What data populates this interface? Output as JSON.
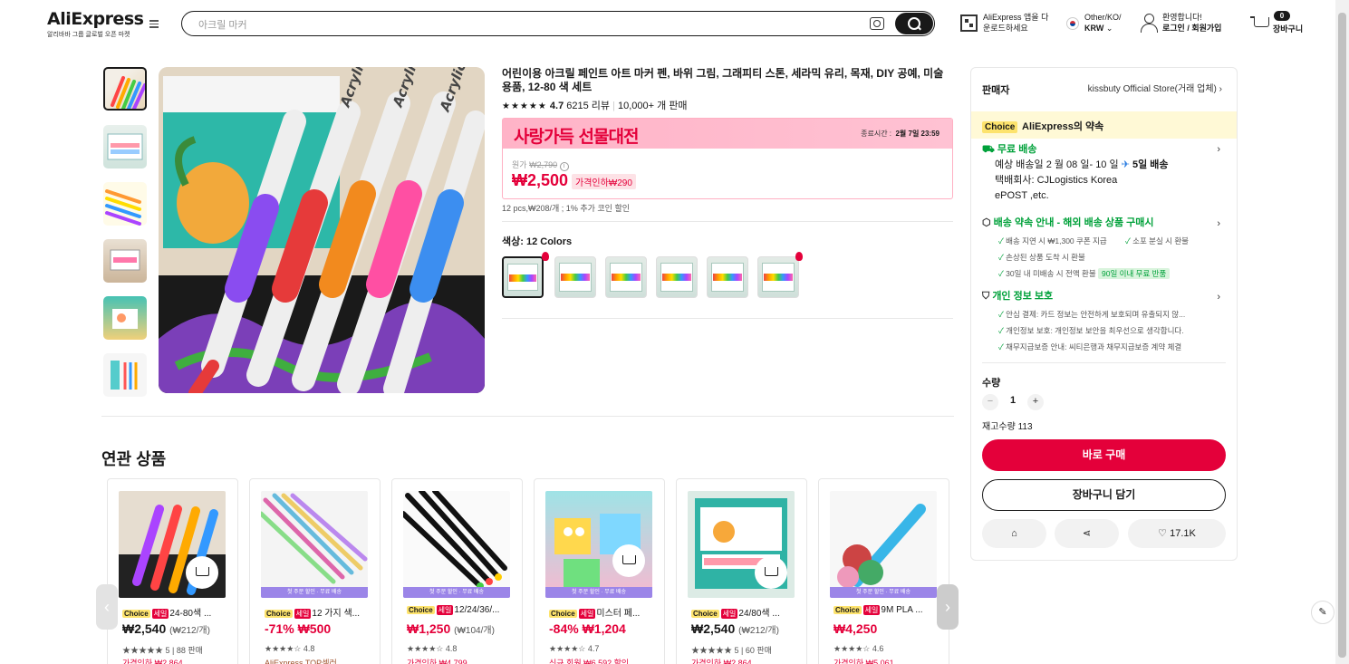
{
  "header": {
    "logo": "AliExpress",
    "logo_sub": "알리바바 그룹 글로벌 오픈 마켓",
    "search_placeholder": "아크릴 마커",
    "app_line1": "AliExpress 앱을 다",
    "app_line2": "운로드하세요",
    "locale_line1": "Other/KO/",
    "locale_line2": "KRW",
    "greeting": "환영합니다!",
    "login": "로그인 / 회원가입",
    "cart_count": "0",
    "cart_label": "장바구니"
  },
  "product": {
    "title": "어린이용 아크릴 페인트 아트 마커 펜, 바위 그림, 그래피티 스톤, 세라믹 유리, 목재, DIY 공예, 미술 용품, 12-80 색 세트",
    "stars": "★★★★★",
    "rating": "4.7",
    "reviews": "6215 리뷰",
    "sold": "10,000+ 개 판매",
    "promo_title": "사랑가득 선물대전",
    "promo_time_label": "종료시간 :",
    "promo_time": "2월 7일 23:59",
    "orig_label": "원가",
    "orig_price": "₩2,790",
    "price": "₩2,500",
    "discount": "가격인하₩290",
    "unit_note": "12 pcs,₩208/개 ; 1% 추가 코인 할인",
    "color_label": "색상: 12 Colors"
  },
  "seller": {
    "label": "판매자",
    "name": "kissbuty Official Store(거래 업체)",
    "choice_badge": "Choice",
    "promise": "AliExpress의 약속",
    "free_shipping": "무료 배송",
    "delivery": "예상 배송일 2 월 08 일- 10 일",
    "fast": "5일 배송",
    "carrier_line1": "택배회사:     CJLogistics     Korea",
    "carrier_line2": "ePOST ,etc.",
    "guarantee": "배송 약속 안내 - 해외 배송 상품 구매시",
    "g1": "배송 지연 시 ₩1,300 쿠폰 지급",
    "g2": "소포 분실 시 환불",
    "g3": "손상된 상품 도착 시 환불",
    "g4": "30일 내 미배송 시 전액 환불",
    "g4_tag": "90일 이내 무료 반품",
    "privacy": "개인 정보 보호",
    "p1": "안심 결제: 카드 정보는 안전하게 보호되며 유출되지 않...",
    "p2": "개인정보 보호: 개인정보 보안을 최우선으로 생각합니다.",
    "p3": "채무지급보증 안내: 씨티은행과 채무지급보증 계약 체결",
    "qty_label": "수량",
    "minus": "−",
    "qty": "1",
    "plus": "+",
    "stock": "재고수량 113",
    "buy": "바로 구매",
    "add_cart": "장바구니 담기",
    "wishlist": "17.1K"
  },
  "related": {
    "title": "연관 상품",
    "items": [
      {
        "title": "24-80색 ...",
        "price": "₩2,540",
        "unit": "(₩212/개)",
        "stars": "★★★★★",
        "rating": "5",
        "sold": "88 판매",
        "extra": "가격인하 ₩2,864"
      },
      {
        "title": "12 가지 색...",
        "price": "-71% ₩500",
        "unit": "",
        "stars": "★★★★☆",
        "rating": "4.8",
        "sold": "",
        "extra": "AliExpress TOP셀러",
        "banner": "첫 주문 할인 · 무료 배송"
      },
      {
        "title": "12/24/36/...",
        "price": "₩1,250",
        "unit": "(₩104/개)",
        "stars": "★★★★☆",
        "rating": "4.8",
        "sold": "",
        "extra": "가격인하 ₩4,799",
        "banner": "첫 주문 할인 · 무료 배송"
      },
      {
        "title": "미스터 페...",
        "price": "-84% ₩1,204",
        "unit": "",
        "stars": "★★★★☆",
        "rating": "4.7",
        "sold": "",
        "extra": "신규 회원 ₩6,592 할인",
        "banner": "첫 주문 할인 · 무료 배송"
      },
      {
        "title": "24/80색 ...",
        "price": "₩2,540",
        "unit": "(₩212/개)",
        "stars": "★★★★★",
        "rating": "5",
        "sold": "60 판매",
        "extra": "가격인하 ₩2,864"
      },
      {
        "title": "9M PLA ...",
        "price": "₩4,250",
        "unit": "",
        "stars": "★★★★☆",
        "rating": "4.6",
        "sold": "",
        "extra": "가격인하 ₩5,061",
        "banner": "첫 주문 할인 · 무료 배송"
      }
    ],
    "choice": "Choice",
    "sale": "세일",
    "prev": "‹",
    "next": "›"
  }
}
